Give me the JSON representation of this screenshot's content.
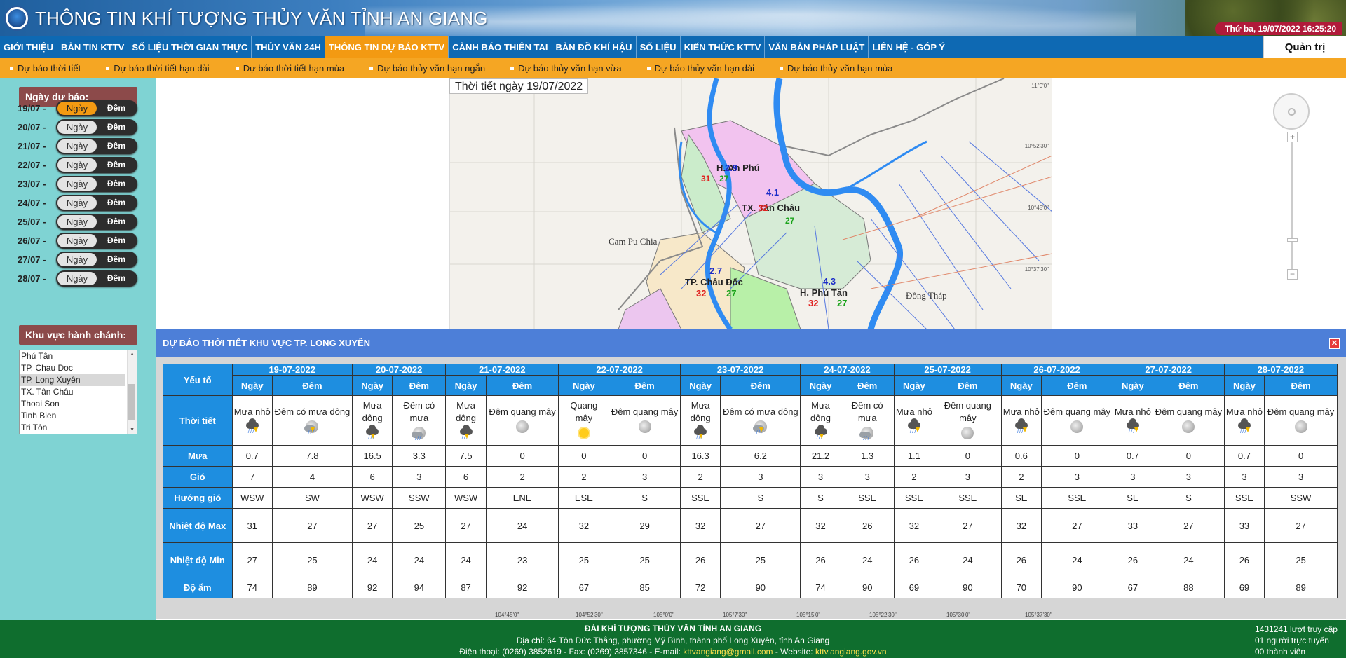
{
  "header": {
    "site_title": "THÔNG TIN KHÍ TƯỢNG THỦY VĂN TỈNH AN GIANG",
    "datetime": "Thứ ba, 19/07/2022 16:25:20",
    "admin_label": "Quản trị"
  },
  "main_nav": [
    {
      "label": "GIỚI THIỆU",
      "active": false
    },
    {
      "label": "BẢN TIN KTTV",
      "active": false
    },
    {
      "label": "SỐ LIỆU THỜI GIAN THỰC",
      "active": false
    },
    {
      "label": "THỦY VĂN 24H",
      "active": false
    },
    {
      "label": "THÔNG TIN DỰ BÁO KTTV",
      "active": true
    },
    {
      "label": "CẢNH BÁO THIÊN TAI",
      "active": false
    },
    {
      "label": "BẢN ĐỒ KHÍ HẬU",
      "active": false
    },
    {
      "label": "SỐ LIỆU",
      "active": false
    },
    {
      "label": "KIẾN THỨC KTTV",
      "active": false
    },
    {
      "label": "VĂN BẢN PHÁP LUẬT",
      "active": false
    },
    {
      "label": "LIÊN HỆ - GÓP Ý",
      "active": false
    }
  ],
  "sub_nav": [
    "Dự báo thời tiết",
    "Dự báo thời tiết hạn dài",
    "Dự báo thời tiết hạn mùa",
    "Dự báo thủy văn hạn ngắn",
    "Dự báo thủy văn hạn vừa",
    "Dự báo thủy văn hạn dài",
    "Dự báo thủy văn hạn mùa"
  ],
  "sidebar": {
    "forecast_day_title": "Ngày dự báo:",
    "day_label": "Ngày",
    "night_label": "Đêm",
    "days": [
      "19/07 -",
      "20/07 -",
      "21/07 -",
      "22/07 -",
      "23/07 -",
      "24/07 -",
      "25/07 -",
      "26/07 -",
      "27/07 -",
      "28/07 -"
    ],
    "selected_day_index": 0,
    "region_title": "Khu vực hành chánh:",
    "regions": [
      "Phú Tân",
      "TP. Chau Doc",
      "TP. Long Xuyên",
      "TX. Tân Châu",
      "Thoai Son",
      "Tinh Bien",
      "Tri Tôn"
    ],
    "selected_region": "TP. Long Xuyên"
  },
  "map": {
    "title": "Thời tiết ngày 19/07/2022",
    "labels": {
      "cambodia": "Cam Pu Chia",
      "dongthap": "Đồng Tháp",
      "anphu": "H. An Phú",
      "tanchau": "TX. Tân Châu",
      "chaudoc": "TP. Châu Đốc",
      "phutan": "H. Phú Tân"
    },
    "stations": {
      "anphu": {
        "rain": "2.9",
        "tmax": "31",
        "tmin": "27"
      },
      "tanchau": {
        "rain": "4.1",
        "tmax": "32",
        "tmin": "27"
      },
      "chaudoc": {
        "rain": "2.7",
        "tmax": "32",
        "tmin": "27"
      },
      "phutan": {
        "rain": "4.3",
        "tmax": "32",
        "tmin": "27"
      }
    },
    "lat_ticks": [
      "11°0'0\"",
      "10°52'30\"",
      "10°45'0\"",
      "10°37'30\""
    ],
    "lon_ticks": [
      "104°45'0\"",
      "104°52'30\"",
      "105°0'0\"",
      "105°7'30\"",
      "105°15'0\"",
      "105°22'30\"",
      "105°30'0\"",
      "105°37'30\""
    ]
  },
  "forecast": {
    "title": "DỰ BÁO THỜI TIẾT KHU VỰC TP. LONG XUYÊN",
    "corner_label": "Yếu tố",
    "day_label": "Ngày",
    "night_label": "Đêm",
    "dates": [
      "19-07-2022",
      "20-07-2022",
      "21-07-2022",
      "22-07-2022",
      "23-07-2022",
      "24-07-2022",
      "25-07-2022",
      "26-07-2022",
      "27-07-2022",
      "28-07-2022"
    ],
    "row_labels": {
      "weather": "Thời tiết",
      "rain": "Mưa",
      "wind": "Gió",
      "wind_dir": "Hướng gió",
      "tmax": "Nhiệt độ Max",
      "tmin": "Nhiệt độ Min",
      "humidity": "Độ ẩm"
    },
    "columns": [
      {
        "weather": "Mưa nhỏ",
        "icon": "rain-light-icon",
        "rain": "0.7",
        "wind": "7",
        "dir": "WSW",
        "tmax": "31",
        "tmin": "27",
        "hum": "74"
      },
      {
        "weather": "Đêm có mưa dông",
        "icon": "night-thunderstorm-icon",
        "rain": "7.8",
        "wind": "4",
        "dir": "SW",
        "tmax": "27",
        "tmin": "25",
        "hum": "89"
      },
      {
        "weather": "Mưa dông",
        "icon": "thunderstorm-icon",
        "rain": "16.5",
        "wind": "6",
        "dir": "WSW",
        "tmax": "27",
        "tmin": "24",
        "hum": "92"
      },
      {
        "weather": "Đêm có mưa",
        "icon": "night-rain-icon",
        "rain": "3.3",
        "wind": "3",
        "dir": "SSW",
        "tmax": "25",
        "tmin": "24",
        "hum": "94"
      },
      {
        "weather": "Mưa dông",
        "icon": "thunderstorm-icon",
        "rain": "7.5",
        "wind": "6",
        "dir": "WSW",
        "tmax": "27",
        "tmin": "24",
        "hum": "87"
      },
      {
        "weather": "Đêm quang mây",
        "icon": "moon-icon",
        "rain": "0",
        "wind": "2",
        "dir": "ENE",
        "tmax": "24",
        "tmin": "23",
        "hum": "92"
      },
      {
        "weather": "Quang mây",
        "icon": "sun-icon",
        "rain": "0",
        "wind": "2",
        "dir": "ESE",
        "tmax": "32",
        "tmin": "25",
        "hum": "67"
      },
      {
        "weather": "Đêm quang mây",
        "icon": "moon-icon",
        "rain": "0",
        "wind": "3",
        "dir": "S",
        "tmax": "29",
        "tmin": "25",
        "hum": "85"
      },
      {
        "weather": "Mưa dông",
        "icon": "thunderstorm-icon",
        "rain": "16.3",
        "wind": "2",
        "dir": "SSE",
        "tmax": "32",
        "tmin": "26",
        "hum": "72"
      },
      {
        "weather": "Đêm có mưa dông",
        "icon": "night-thunderstorm-icon",
        "rain": "6.2",
        "wind": "3",
        "dir": "S",
        "tmax": "27",
        "tmin": "25",
        "hum": "90"
      },
      {
        "weather": "Mưa dông",
        "icon": "thunderstorm-icon",
        "rain": "21.2",
        "wind": "3",
        "dir": "S",
        "tmax": "32",
        "tmin": "26",
        "hum": "74"
      },
      {
        "weather": "Đêm có mưa",
        "icon": "night-rain-icon",
        "rain": "1.3",
        "wind": "3",
        "dir": "SSE",
        "tmax": "26",
        "tmin": "24",
        "hum": "90"
      },
      {
        "weather": "Mưa nhỏ",
        "icon": "rain-light-icon",
        "rain": "1.1",
        "wind": "2",
        "dir": "SSE",
        "tmax": "32",
        "tmin": "26",
        "hum": "69"
      },
      {
        "weather": "Đêm quang mây",
        "icon": "moon-icon",
        "rain": "0",
        "wind": "3",
        "dir": "SSE",
        "tmax": "27",
        "tmin": "24",
        "hum": "90"
      },
      {
        "weather": "Mưa nhỏ",
        "icon": "rain-light-icon",
        "rain": "0.6",
        "wind": "2",
        "dir": "SE",
        "tmax": "32",
        "tmin": "26",
        "hum": "70"
      },
      {
        "weather": "Đêm quang mây",
        "icon": "moon-icon",
        "rain": "0",
        "wind": "3",
        "dir": "SSE",
        "tmax": "27",
        "tmin": "24",
        "hum": "90"
      },
      {
        "weather": "Mưa nhỏ",
        "icon": "rain-light-icon",
        "rain": "0.7",
        "wind": "3",
        "dir": "SE",
        "tmax": "33",
        "tmin": "26",
        "hum": "67"
      },
      {
        "weather": "Đêm quang mây",
        "icon": "moon-icon",
        "rain": "0",
        "wind": "3",
        "dir": "S",
        "tmax": "27",
        "tmin": "24",
        "hum": "88"
      },
      {
        "weather": "Mưa nhỏ",
        "icon": "rain-light-icon",
        "rain": "0.7",
        "wind": "3",
        "dir": "SSE",
        "tmax": "33",
        "tmin": "26",
        "hum": "69"
      },
      {
        "weather": "Đêm quang mây",
        "icon": "moon-icon",
        "rain": "0",
        "wind": "3",
        "dir": "SSW",
        "tmax": "27",
        "tmin": "25",
        "hum": "89"
      }
    ]
  },
  "footer": {
    "org": "ĐÀI KHÍ TƯỢNG THỦY VĂN TỈNH AN GIANG",
    "address": "Địa chỉ: 64 Tôn Đức Thắng, phường Mỹ Bình, thành phố Long Xuyên, tỉnh An Giang",
    "phone_text": "Điện thoại: (0269) 3852619  -  Fax: (0269) 3857346 - E-mail: ",
    "email": "kttvangiang@gmail.com",
    "web_text": "  -  Website: ",
    "website": "kttv.angiang.gov.vn",
    "visits": "1431241 lượt truy cập",
    "online": "01 người trực tuyến",
    "members": "00 thành viên"
  },
  "colors": {
    "nav_blue": "#0e69b3",
    "nav_active": "#f39a12",
    "subnav": "#f5a623",
    "sidebar": "#7fd3d3",
    "table_header": "#1e8ee0",
    "panel_header": "#4d7fd8",
    "footer": "#0f6e2e",
    "tmax_red": "#e0201f",
    "tmin_green": "#1aa31a",
    "rain_blue": "#1b2cc8"
  }
}
